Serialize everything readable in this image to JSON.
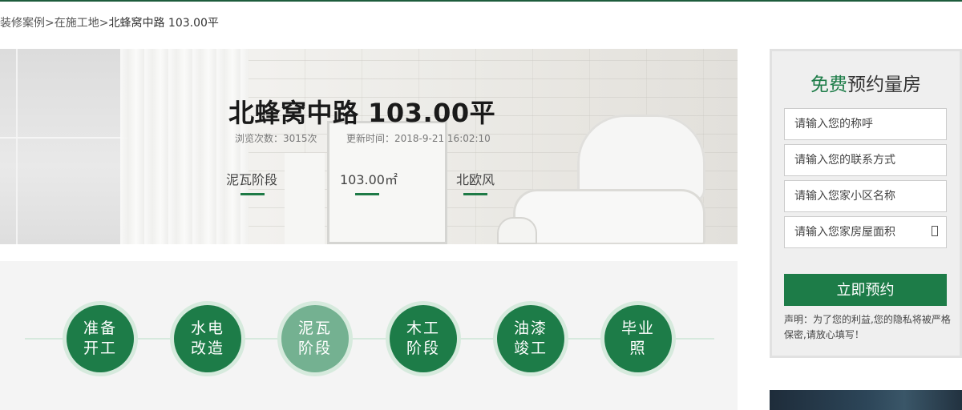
{
  "breadcrumb": {
    "items": [
      "装修案例",
      "在施工地",
      "北蜂窝中路 103.00平"
    ],
    "separator": ">"
  },
  "hero": {
    "title": "北蜂窝中路 103.00平",
    "views": "浏览次数：3015次",
    "updated": "更新时间：2018-9-21  16:02:10",
    "stage": "泥瓦阶段",
    "area": "103.00㎡",
    "style": "北欧风"
  },
  "progress": {
    "steps": [
      {
        "line1": "准备",
        "line2": "开工",
        "active": false
      },
      {
        "line1": "水电",
        "line2": "改造",
        "active": false
      },
      {
        "line1": "泥瓦",
        "line2": "阶段",
        "active": true
      },
      {
        "line1": "木工",
        "line2": "阶段",
        "active": false
      },
      {
        "line1": "油漆",
        "line2": "竣工",
        "active": false
      },
      {
        "line1": "毕业",
        "line2": "照",
        "active": false
      }
    ]
  },
  "form": {
    "title_highlight": "免费",
    "title_rest": "预约量房",
    "name_placeholder": "请输入您的称呼",
    "phone_placeholder": "请输入您的联系方式",
    "community_placeholder": "请输入您家小区名称",
    "area_placeholder": "请输入您家房屋面积",
    "submit_label": "立即预约",
    "note": "声明：为了您的利益,您的隐私将被严格保密,请放心填写！"
  },
  "colors": {
    "accent": "#1d7c48",
    "accent_light": "#74b191",
    "ring": "#d6eadd"
  }
}
